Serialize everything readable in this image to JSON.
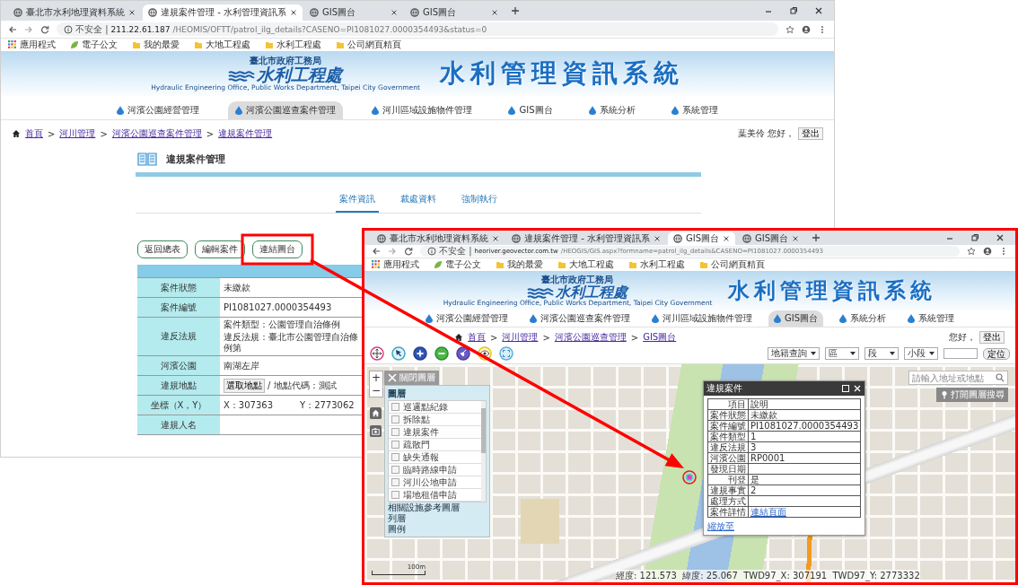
{
  "windows": [
    {
      "kind": "case",
      "tabs": [
        {
          "title": "臺北市水利地理資料系統",
          "selected": false
        },
        {
          "title": "違規案件管理 - 水利管理資訊系",
          "selected": true
        },
        {
          "title": "GIS圖台",
          "selected": false
        },
        {
          "title": "GIS圖台",
          "selected": false
        }
      ],
      "address": {
        "security": "不安全 |",
        "host": "211.22.61.187",
        "path": "/HEOMIS/OFTT/patrol_ilg_details?CASENO=PI1081027.0000354493&status=0"
      },
      "bookmarks": [
        {
          "kind": "apps",
          "label": "應用程式"
        },
        {
          "kind": "leaf",
          "label": "電子公文"
        },
        {
          "kind": "folder",
          "label": "我的最愛"
        },
        {
          "kind": "folder",
          "label": "大地工程處"
        },
        {
          "kind": "folder",
          "label": "水利工程處"
        },
        {
          "kind": "folder",
          "label": "公司網頁精頁"
        }
      ],
      "banner": {
        "agency": "臺北市政府工務局",
        "office": "水利工程處",
        "office_en": "Hydraulic Engineering Office, Public Works Department, Taipei City Government",
        "system": "水利管理資訊系統"
      },
      "nav": [
        {
          "label": "河濱公園經營管理",
          "selected": false
        },
        {
          "label": "河濱公園巡查案件管理",
          "selected": true
        },
        {
          "label": "河川區域設施物件管理",
          "selected": false
        },
        {
          "label": "GIS圖台",
          "selected": false
        },
        {
          "label": "系統分析",
          "selected": false
        },
        {
          "label": "系統管理",
          "selected": false
        }
      ],
      "breadcrumb": [
        "首頁",
        "河川管理",
        "河濱公園巡查案件管理",
        "違規案件管理"
      ],
      "separator": ">",
      "greeting": "葉美伶 您好，",
      "logout": "登出",
      "page": {
        "title": "違規案件管理",
        "tabs": [
          {
            "label": "案件資訊",
            "selected": true
          },
          {
            "label": "裁處資料",
            "selected": false
          },
          {
            "label": "強制執行",
            "selected": false
          }
        ],
        "buttons": [
          "返回總表",
          "編輯案件",
          "連結圖台"
        ],
        "rows": [
          {
            "kind": "text",
            "label": "案件狀態",
            "lines": [
              "未繳款"
            ]
          },
          {
            "kind": "text",
            "label": "案件編號",
            "lines": [
              "PI1081027.0000354493"
            ]
          },
          {
            "kind": "text",
            "label": "違反法規",
            "lines": [
              "案件類型：公園管理自治條例",
              "違反法規：臺北市公園管理自治條例第"
            ]
          },
          {
            "kind": "text",
            "label": "河濱公園",
            "lines": [
              "南湖左岸"
            ]
          },
          {
            "kind": "location",
            "label": "違規地點",
            "button": "選取地點",
            "lines": [
              "/ 地點代碼：測試"
            ]
          },
          {
            "kind": "coords",
            "label": "坐標（X，Y）",
            "lines": [
              "X：307363",
              "Y：2773062"
            ]
          },
          {
            "kind": "text",
            "label": "違規人名"
          }
        ]
      }
    },
    {
      "kind": "gis",
      "tabs": [
        {
          "title": "臺北市水利地理資料系統",
          "selected": false
        },
        {
          "title": "違規案件管理 - 水利管理資訊系",
          "selected": false
        },
        {
          "title": "GIS圖台",
          "selected": true
        },
        {
          "title": "GIS圖台",
          "selected": false
        }
      ],
      "address": {
        "security": "不安全 |",
        "host": "heoriver.geovector.com.tw",
        "path": "/HEOGIS/GIS.aspx?formname=patrol_ilg_details&CASENO=PI1081027.0000354493"
      },
      "bookmarks": [
        {
          "kind": "apps",
          "label": "應用程式"
        },
        {
          "kind": "leaf",
          "label": "電子公文"
        },
        {
          "kind": "folder",
          "label": "我的最愛"
        },
        {
          "kind": "folder",
          "label": "大地工程處"
        },
        {
          "kind": "folder",
          "label": "水利工程處"
        },
        {
          "kind": "folder",
          "label": "公司網頁精頁"
        }
      ],
      "banner": {
        "agency": "臺北市政府工務局",
        "office": "水利工程處",
        "office_en": "Hydraulic Engineering Office, Public Works Department, Taipei City Government",
        "system": "水利管理資訊系統"
      },
      "nav": [
        {
          "label": "河濱公園經營管理",
          "selected": false
        },
        {
          "label": "河濱公園巡查案件管理",
          "selected": false
        },
        {
          "label": "河川區域設施物件管理",
          "selected": false
        },
        {
          "label": "GIS圖台",
          "selected": true
        },
        {
          "label": "系統分析",
          "selected": false
        },
        {
          "label": "系統管理",
          "selected": false
        }
      ],
      "breadcrumb": [
        "首頁",
        "河川管理",
        "河濱公園巡查管理",
        "GIS圖台"
      ],
      "separator": ">",
      "greeting": "您好，",
      "logout": "登出",
      "gis": {
        "query": {
          "mode": "地籍查詢",
          "selects": [
            "區",
            "段",
            "小段"
          ],
          "button": "定位"
        },
        "zoom": [
          "+",
          "−"
        ],
        "layer_panel": {
          "close": "關閉圖層",
          "title": "圖層",
          "layers": [
            {
              "label": "巡邏點紀錄",
              "checked": false
            },
            {
              "label": "拆除點",
              "checked": false
            },
            {
              "label": "違規案件",
              "checked": false
            },
            {
              "label": "疏散門",
              "checked": false
            },
            {
              "label": "缺失通報",
              "checked": false
            },
            {
              "label": "臨時路線申請",
              "checked": false
            },
            {
              "label": "河川公地申請",
              "checked": false
            },
            {
              "label": "場地租借申請",
              "checked": false
            }
          ],
          "sections": [
            "相關設施參考圖層",
            "列層",
            "圖例"
          ]
        },
        "search": {
          "placeholder": "請輸入地址或地點"
        },
        "layer_search": "打開圖層搜尋",
        "popup": {
          "title": "違規案件",
          "rows": [
            {
              "label": "項目",
              "value": "說明"
            },
            {
              "label": "案件狀態",
              "value": "未繳款"
            },
            {
              "label": "案件編號",
              "value": "PI1081027.0000354493"
            },
            {
              "label": "案件類型",
              "value": "1"
            },
            {
              "label": "違反法規",
              "value": "3"
            },
            {
              "label": "河濱公園",
              "value": "RP0001"
            },
            {
              "label": "發現日期"
            },
            {
              "label": "刊登",
              "value": "是"
            },
            {
              "label": "違規事實",
              "value": "2"
            },
            {
              "label": "處理方式"
            },
            {
              "label": "案件詳情",
              "value": "連結頁面",
              "link": true
            }
          ],
          "zoom_to": "縮放至"
        },
        "scale": "100m",
        "status": "經度: 121.573  緯度: 25.067  TWD97_X: 307191  TWD97_Y: 2773332"
      }
    }
  ]
}
